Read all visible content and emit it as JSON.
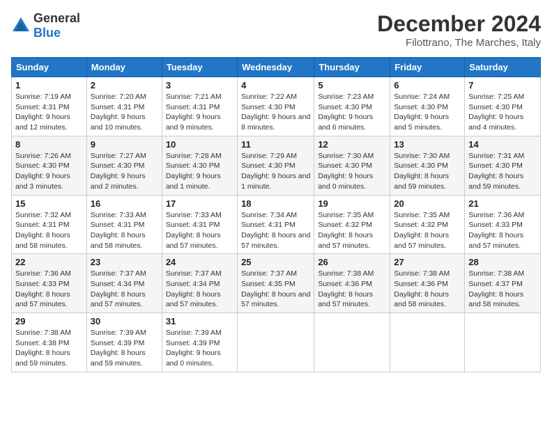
{
  "logo": {
    "text_general": "General",
    "text_blue": "Blue"
  },
  "header": {
    "month_year": "December 2024",
    "location": "Filottrano, The Marches, Italy"
  },
  "weekdays": [
    "Sunday",
    "Monday",
    "Tuesday",
    "Wednesday",
    "Thursday",
    "Friday",
    "Saturday"
  ],
  "weeks": [
    [
      {
        "day": "1",
        "sunrise": "7:19 AM",
        "sunset": "4:31 PM",
        "daylight": "9 hours and 12 minutes."
      },
      {
        "day": "2",
        "sunrise": "7:20 AM",
        "sunset": "4:31 PM",
        "daylight": "9 hours and 10 minutes."
      },
      {
        "day": "3",
        "sunrise": "7:21 AM",
        "sunset": "4:31 PM",
        "daylight": "9 hours and 9 minutes."
      },
      {
        "day": "4",
        "sunrise": "7:22 AM",
        "sunset": "4:30 PM",
        "daylight": "9 hours and 8 minutes."
      },
      {
        "day": "5",
        "sunrise": "7:23 AM",
        "sunset": "4:30 PM",
        "daylight": "9 hours and 6 minutes."
      },
      {
        "day": "6",
        "sunrise": "7:24 AM",
        "sunset": "4:30 PM",
        "daylight": "9 hours and 5 minutes."
      },
      {
        "day": "7",
        "sunrise": "7:25 AM",
        "sunset": "4:30 PM",
        "daylight": "9 hours and 4 minutes."
      }
    ],
    [
      {
        "day": "8",
        "sunrise": "7:26 AM",
        "sunset": "4:30 PM",
        "daylight": "9 hours and 3 minutes."
      },
      {
        "day": "9",
        "sunrise": "7:27 AM",
        "sunset": "4:30 PM",
        "daylight": "9 hours and 2 minutes."
      },
      {
        "day": "10",
        "sunrise": "7:28 AM",
        "sunset": "4:30 PM",
        "daylight": "9 hours and 1 minute."
      },
      {
        "day": "11",
        "sunrise": "7:29 AM",
        "sunset": "4:30 PM",
        "daylight": "9 hours and 1 minute."
      },
      {
        "day": "12",
        "sunrise": "7:30 AM",
        "sunset": "4:30 PM",
        "daylight": "9 hours and 0 minutes."
      },
      {
        "day": "13",
        "sunrise": "7:30 AM",
        "sunset": "4:30 PM",
        "daylight": "8 hours and 59 minutes."
      },
      {
        "day": "14",
        "sunrise": "7:31 AM",
        "sunset": "4:30 PM",
        "daylight": "8 hours and 59 minutes."
      }
    ],
    [
      {
        "day": "15",
        "sunrise": "7:32 AM",
        "sunset": "4:31 PM",
        "daylight": "8 hours and 58 minutes."
      },
      {
        "day": "16",
        "sunrise": "7:33 AM",
        "sunset": "4:31 PM",
        "daylight": "8 hours and 58 minutes."
      },
      {
        "day": "17",
        "sunrise": "7:33 AM",
        "sunset": "4:31 PM",
        "daylight": "8 hours and 57 minutes."
      },
      {
        "day": "18",
        "sunrise": "7:34 AM",
        "sunset": "4:31 PM",
        "daylight": "8 hours and 57 minutes."
      },
      {
        "day": "19",
        "sunrise": "7:35 AM",
        "sunset": "4:32 PM",
        "daylight": "8 hours and 57 minutes."
      },
      {
        "day": "20",
        "sunrise": "7:35 AM",
        "sunset": "4:32 PM",
        "daylight": "8 hours and 57 minutes."
      },
      {
        "day": "21",
        "sunrise": "7:36 AM",
        "sunset": "4:33 PM",
        "daylight": "8 hours and 57 minutes."
      }
    ],
    [
      {
        "day": "22",
        "sunrise": "7:36 AM",
        "sunset": "4:33 PM",
        "daylight": "8 hours and 57 minutes."
      },
      {
        "day": "23",
        "sunrise": "7:37 AM",
        "sunset": "4:34 PM",
        "daylight": "8 hours and 57 minutes."
      },
      {
        "day": "24",
        "sunrise": "7:37 AM",
        "sunset": "4:34 PM",
        "daylight": "8 hours and 57 minutes."
      },
      {
        "day": "25",
        "sunrise": "7:37 AM",
        "sunset": "4:35 PM",
        "daylight": "8 hours and 57 minutes."
      },
      {
        "day": "26",
        "sunrise": "7:38 AM",
        "sunset": "4:36 PM",
        "daylight": "8 hours and 57 minutes."
      },
      {
        "day": "27",
        "sunrise": "7:38 AM",
        "sunset": "4:36 PM",
        "daylight": "8 hours and 58 minutes."
      },
      {
        "day": "28",
        "sunrise": "7:38 AM",
        "sunset": "4:37 PM",
        "daylight": "8 hours and 58 minutes."
      }
    ],
    [
      {
        "day": "29",
        "sunrise": "7:38 AM",
        "sunset": "4:38 PM",
        "daylight": "8 hours and 59 minutes."
      },
      {
        "day": "30",
        "sunrise": "7:39 AM",
        "sunset": "4:39 PM",
        "daylight": "8 hours and 59 minutes."
      },
      {
        "day": "31",
        "sunrise": "7:39 AM",
        "sunset": "4:39 PM",
        "daylight": "9 hours and 0 minutes."
      },
      null,
      null,
      null,
      null
    ]
  ]
}
